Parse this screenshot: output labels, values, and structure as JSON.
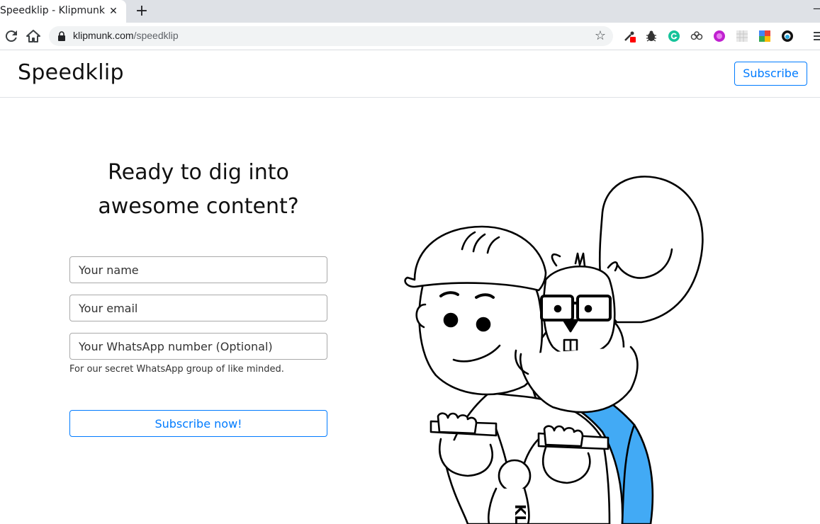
{
  "browser": {
    "tab_title": "Speedklip - Klipmunk",
    "close_glyph": "✕",
    "newtab_glyph": "+",
    "url_host": "klipmunk.com",
    "url_path": "/speedklip",
    "star_glyph": "☆",
    "extensions": [
      "color-picker-icon",
      "bug-icon",
      "grammarly-icon",
      "link-icon",
      "purple-extension-icon",
      "grid-extension-icon",
      "google-extension-icon",
      "circle-extension-icon"
    ]
  },
  "navbar": {
    "brand": "Speedklip",
    "subscribe_label": "Subscribe"
  },
  "hero": {
    "headline_line1": "Ready to dig into",
    "headline_line2": "awesome content?"
  },
  "form": {
    "name_placeholder": "Your name",
    "email_placeholder": "Your email",
    "whatsapp_placeholder": "Your WhatsApp number (Optional)",
    "whatsapp_help": "For our secret WhatsApp group of like minded.",
    "submit_label": "Subscribe now!"
  },
  "illustration": {
    "bike_text": "KL",
    "accent_color": "#42aaf5"
  }
}
